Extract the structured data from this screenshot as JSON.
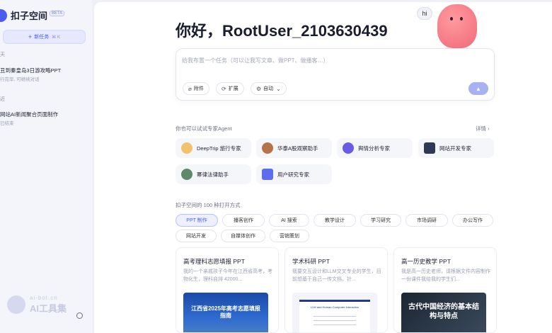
{
  "sidebar": {
    "logo": "扣子空间",
    "beta": "BETA",
    "new_task": {
      "label": "新任务",
      "shortcut": "⌘ K"
    },
    "groups": [
      {
        "label": "天",
        "items": [
          {
            "title": "丑到秦皇岛3日游攻略PPT",
            "subtitle": "行完毕, 可继续对话"
          }
        ]
      },
      {
        "label": "近",
        "items": [
          {
            "title": "网站AI新闻聚合页面制作",
            "subtitle": "已结束"
          }
        ]
      }
    ],
    "watermark": {
      "line1": "ai-bot.cn",
      "line2": "AI工具集"
    }
  },
  "main": {
    "greeting": "你好，RootUser_2103630439",
    "mascot_bubble": "hi",
    "input": {
      "placeholder": "给我布置一个任务（可以让我写文章、做PPT、做播客…）",
      "value": "",
      "chips": [
        {
          "icon": "paperclip-icon",
          "label": "附件"
        },
        {
          "icon": "expand-icon",
          "label": "扩展"
        },
        {
          "icon": "auto-icon",
          "label": "自动"
        }
      ],
      "send_icon": "send-icon"
    },
    "agents_section": {
      "label": "你也可以试试专家Agent",
      "details": "详情",
      "agents": [
        {
          "name": "DeepTrip 旅行专家",
          "color": "#f2c36b"
        },
        {
          "name": "华泰A股观察助手",
          "color": "#b5734a"
        },
        {
          "name": "舆情分析专家",
          "color": "#6b5ce6"
        },
        {
          "name": "网站开发专家",
          "color": "#2b3a55"
        },
        {
          "name": "幂律法律助手",
          "color": "#5c8a6a"
        },
        {
          "name": "用户研究专家",
          "color": "#5b6ef0"
        }
      ]
    },
    "uses_section": {
      "label": "扣子空间的 100 种打开方式",
      "tabs": [
        "PPT 制作",
        "播客创作",
        "AI 搜索",
        "教学设计",
        "学习研究",
        "市场调研",
        "办公写作",
        "网站开发",
        "自媒体创作",
        "营销策划"
      ],
      "active_tab": "PPT 制作"
    },
    "cards": [
      {
        "title": "高考理科志愿填报 PPT",
        "desc": "我的一个亲戚孩子今年在江西省高考，考物化生，理科自排 42000...",
        "thumb_title": "江西省2025年高考志愿填报指南"
      },
      {
        "title": "学术科研 PPT",
        "desc": "我要交互设计和LLM交叉专业的学生，目前想基于自己一传文档，针...",
        "thumb_title": "LLM and Human-Computer Interaction"
      },
      {
        "title": "高一历史教学 PPT",
        "desc": "我是高一历史老师，请根据文件内容制作一份课件我给我的学生们...",
        "thumb_title": "古代中国经济的基本结构与特点"
      }
    ]
  }
}
